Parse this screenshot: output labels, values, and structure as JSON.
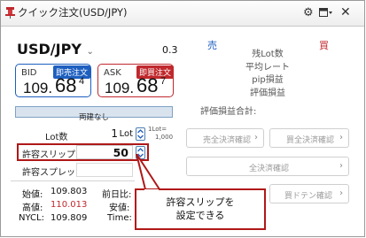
{
  "window": {
    "title": "クイック注文(USD/JPY)",
    "icons": {
      "app": "pin-icon",
      "settings": "gear-icon",
      "layout": "layout-dropdown-icon",
      "close": "close-icon"
    }
  },
  "symbol": {
    "pair": "USD/JPY",
    "spread": "0.3"
  },
  "bid": {
    "label": "BID",
    "action": "即売注文",
    "price_main": "109.",
    "price_big": "68",
    "price_sub": "4"
  },
  "ask": {
    "label": "ASK",
    "action": "即買注文",
    "price_main": "109.",
    "price_big": "68",
    "price_sub": "7"
  },
  "settlement": {
    "label": "両建なし"
  },
  "lot": {
    "label": "Lot数",
    "value": "1",
    "unit": "Lot",
    "note_line1": "1Lot=",
    "note_line2": "1,000"
  },
  "slip": {
    "label": "許容スリップ",
    "value": "50"
  },
  "spread_limit": {
    "label": "許容スプレッド",
    "value": ""
  },
  "stats": {
    "open_label": "始値:",
    "open_value": "109.803",
    "high_label": "高値:",
    "high_value": "110.013",
    "nycl_label": "NYCL:",
    "nycl_value": "109.809",
    "prev_label": "前日比:",
    "low_label": "安値:",
    "time_label": "Time:"
  },
  "positions": {
    "sell_header": "売",
    "buy_header": "買",
    "rows": [
      "残Lot数",
      "平均レート",
      "pip損益",
      "評価損益"
    ],
    "total_label": "評価損益合計:"
  },
  "buttons": {
    "sell_close": "売全決済確認",
    "buy_close": "買全決済確認",
    "all_close": "全決済確認",
    "buy_doten": "買ドテン確認",
    "chevron": "›"
  },
  "callout": {
    "line1": "許容スリップを",
    "line2": "設定できる"
  },
  "colors": {
    "sell_blue": "#1d5fbf",
    "buy_red": "#c0282d",
    "highlight_red": "#b01818",
    "high_value_red": "#c0282d"
  }
}
